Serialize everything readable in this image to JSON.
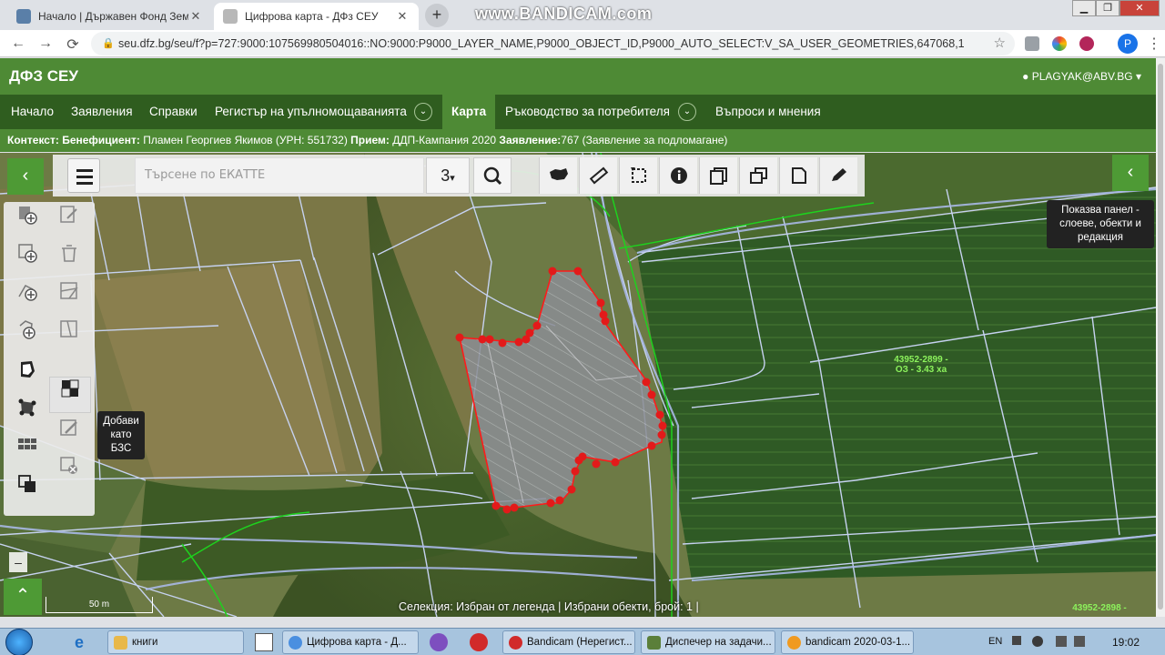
{
  "browser": {
    "tabs": [
      {
        "title": "Начало | Държавен Фонд Земе",
        "close": "✕",
        "favicon_color": "#5a7fa8"
      },
      {
        "title": "Цифрова карта - ДФз СЕУ",
        "close": "✕",
        "favicon_color": "#888888"
      }
    ],
    "new_tab": "+",
    "watermark": "www.BANDICAM.com",
    "window_controls": {
      "minimize": "▁",
      "maximize": "❐",
      "close": "✕"
    },
    "url": "seu.dfz.bg/seu/f?p=727:9000:107569980504016::NO:9000:P9000_LAYER_NAME,P9000_OBJECT_ID,P9000_AUTO_SELECT:V_SA_USER_GEOMETRIES,647068,1",
    "profile_initial": "P",
    "nav_icons": {
      "back": "←",
      "forward": "→",
      "reload": "⟳",
      "lock": "🔒",
      "star": "☆",
      "menu": "⋮"
    }
  },
  "app": {
    "brand": "ДФЗ СЕУ",
    "user": "PLAGYAK@ABV.BG",
    "user_caret": "▾",
    "nav": [
      {
        "label": "Начало"
      },
      {
        "label": "Заявления"
      },
      {
        "label": "Справки"
      },
      {
        "label": "Регистър на упълномощаванията",
        "dropdown": true
      },
      {
        "label": "Карта",
        "active": true
      },
      {
        "label": "Ръководство за потребителя",
        "dropdown": true
      },
      {
        "label": "Въпроси и мнения"
      }
    ],
    "chevron": "⌄",
    "context": {
      "context_label": "Контекст:",
      "beneficiary_label": "Бенефициент:",
      "beneficiary_value": "Пламен Георгиев Якимов (УРН: 551732)",
      "intake_label": "Прием:",
      "intake_value": "ДДП-Кампания 2020",
      "application_label": "Заявление:",
      "application_value": "767 (Заявление за подломагане)"
    }
  },
  "map": {
    "search_placeholder": "Търсене по ЕКАТТЕ",
    "zoom_level": "3",
    "zoom_caret": "▾",
    "collapse_left": "‹",
    "collapse_right": "‹",
    "scroll_up": "⌃",
    "zoom_out": "–",
    "right_panel_tooltip": "Показва панел - слоеве, обекти и редакция",
    "left_tooltip": "Добави като БЗС",
    "scale_label": "50 m",
    "status": "Селекция: Избран от легенда  |  Избрани обекти, брой: 1  |",
    "parcel_labels": [
      {
        "id": "43952-2899 -",
        "detail": "ОЗ - 3.43 ха"
      },
      {
        "id": "43952-2898 -",
        "detail": ""
      }
    ],
    "colors": {
      "parcel_outline": "#c6d2f0",
      "selected_outline": "#ff1a1a",
      "vertex": "#e31a1a",
      "green_line": "#1ed21e",
      "accent": "#4e8a35",
      "nav_dark": "#2f5d1f"
    }
  },
  "taskbar": {
    "tasks": [
      {
        "label": "книги",
        "color": "#e8b84a"
      },
      {
        "label": "Цифрова карта - Д...",
        "color": "#4a8fe0"
      },
      {
        "label": "Bandicam (Нерегист...",
        "color": "#d12a2a"
      },
      {
        "label": "Диспечер на задачи...",
        "color": "#5b7f3a"
      },
      {
        "label": "bandicam 2020-03-1...",
        "color": "#f09a20"
      }
    ],
    "lang": "EN",
    "time": "19:02"
  }
}
